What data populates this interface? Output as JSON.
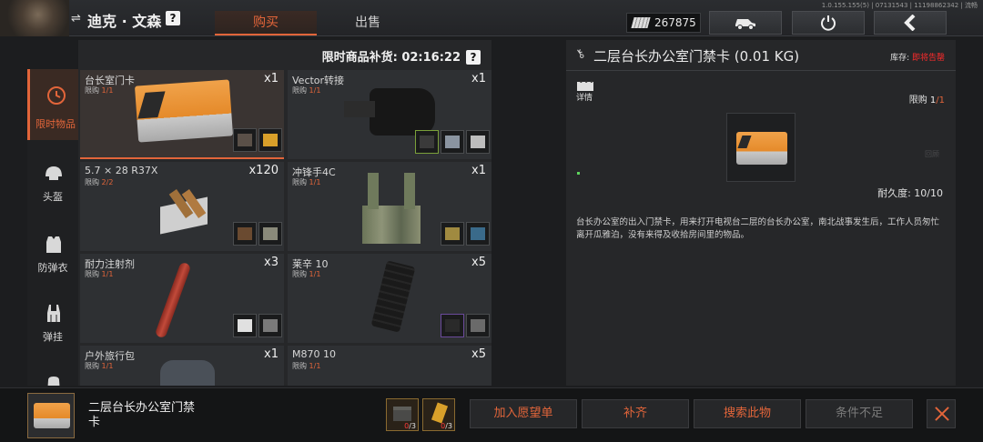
{
  "topbar": {
    "player_name": "迪克 · 文森",
    "help": "?",
    "tabs": [
      {
        "label": "购买",
        "active": true
      },
      {
        "label": "出售",
        "active": false
      }
    ],
    "version": "1.0.155.155(5) | 07131543 | 11198862342 | 流畅",
    "currency_value": "267875"
  },
  "categories": [
    {
      "label": "限时物品",
      "icon": "clock-icon",
      "active": true
    },
    {
      "label": "头盔",
      "icon": "helmet-icon",
      "active": false
    },
    {
      "label": "防弹衣",
      "icon": "vest-icon",
      "active": false
    },
    {
      "label": "弹挂",
      "icon": "rig-icon",
      "active": false
    }
  ],
  "grid": {
    "restock_label": "限时商品补货: 02:16:22",
    "items": [
      {
        "name": "台长室门卡",
        "limit_label": "限购",
        "limit": "1/1",
        "qty": "x1",
        "selected": true
      },
      {
        "name": "Vector转接",
        "limit_label": "限购",
        "limit": "1/1",
        "qty": "x1",
        "selected": false
      },
      {
        "name": "5.7 × 28 R37X",
        "limit_label": "限购",
        "limit": "2/2",
        "qty": "x120",
        "selected": false
      },
      {
        "name": "冲锋手4C",
        "limit_label": "限购",
        "limit": "1/1",
        "qty": "x1",
        "selected": false
      },
      {
        "name": "耐力注射剂",
        "limit_label": "限购",
        "limit": "1/1",
        "qty": "x3",
        "selected": false
      },
      {
        "name": "莱辛 10",
        "limit_label": "限购",
        "limit": "1/1",
        "qty": "x5",
        "selected": false
      },
      {
        "name": "户外旅行包",
        "limit_label": "限购",
        "limit": "1/1",
        "qty": "x1",
        "selected": false
      },
      {
        "name": "M870 10",
        "limit_label": "限购",
        "limit": "1/1",
        "qty": "x5",
        "selected": false
      }
    ]
  },
  "detail": {
    "title": "二层台长办公室门禁卡 (0.01 KG)",
    "stock_label": "库存:",
    "stock_value": "即将告罄",
    "tab_label": "详情",
    "limit_label": "限购",
    "limit_a": "1",
    "limit_b": "/1",
    "durability": "耐久度: 10/10",
    "description": "台长办公室的出入门禁卡，用来打开电视台二层的台长办公室，南北战事发生后，工作人员匆忙离开瓜雅泊，没有来得及收拾房间里的物品。",
    "faint_label": "回顾"
  },
  "bottom": {
    "item_name": "二层台长办公室门禁卡",
    "requirements": [
      {
        "have": "0",
        "need": "/3",
        "icon": "box-icon"
      },
      {
        "have": "0",
        "need": "/3",
        "icon": "gold-bar-icon"
      }
    ],
    "buttons": {
      "wishlist": "加入愿望单",
      "fill": "补齐",
      "search": "搜索此物",
      "disabled": "条件不足"
    }
  },
  "colors": {
    "accent": "#e2653a",
    "warning": "#ff2b2b",
    "bg": "#1c1d1f",
    "panel": "#262729"
  }
}
